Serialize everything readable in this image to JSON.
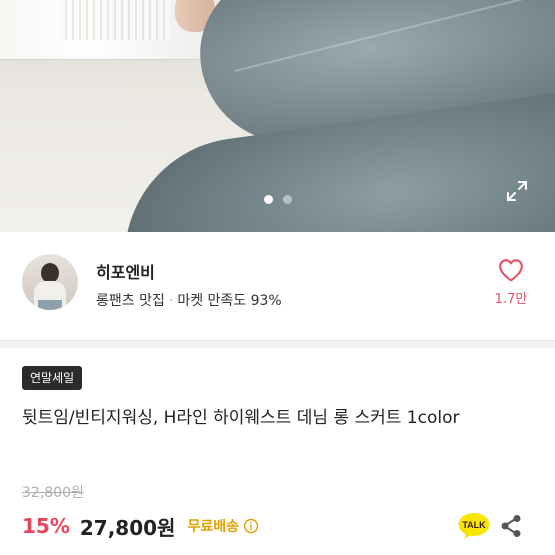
{
  "carousel": {
    "dots": [
      true,
      false
    ],
    "expand_icon": "expand-icon"
  },
  "seller": {
    "name": "히포엔비",
    "category": "롱팬츠 맛집",
    "separator": "·",
    "satisfaction": "마켓 만족도 93%",
    "like_count": "1.7만",
    "like_icon": "heart-outline-icon"
  },
  "product": {
    "badge": "연말세일",
    "title": "뒷트임/빈티지워싱, H라인 하이웨스트 데님 롱 스커트 1color",
    "original_price": "32,800원",
    "discount": "15%",
    "price": "27,800원",
    "shipping": "무료배송",
    "shipping_info_icon": "info-circle-icon"
  },
  "actions": {
    "talk_label": "TALK",
    "talk_icon": "kakao-talk-icon",
    "share_icon": "share-icon"
  },
  "colors": {
    "discount": "#e9455e",
    "like": "#e0566a",
    "shipping": "#e3a100",
    "talk_bg": "#f7e600"
  }
}
